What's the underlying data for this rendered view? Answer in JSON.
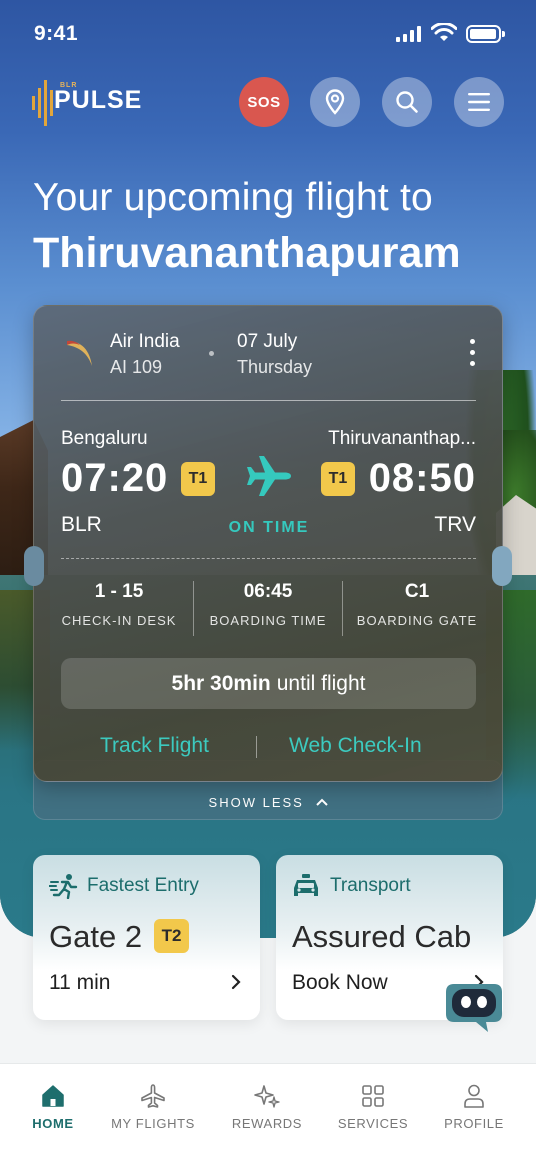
{
  "status_bar": {
    "time": "9:41"
  },
  "header": {
    "logo_text": "PULSE",
    "logo_sub": "BLR",
    "sos_label": "SOS"
  },
  "headline": {
    "line1": "Your upcoming flight to",
    "line2": "Thiruvananthapuram"
  },
  "flight": {
    "airline": "Air India",
    "flight_number": "AI 109",
    "date": "07 July",
    "day": "Thursday",
    "from_city": "Bengaluru",
    "to_city": "Thiruvananthap...",
    "departure_time": "07:20",
    "arrival_time": "08:50",
    "departure_terminal": "T1",
    "arrival_terminal": "T1",
    "from_code": "BLR",
    "to_code": "TRV",
    "status": "ON TIME",
    "status_color": "#35c9be",
    "checkin_desk": "1 - 15",
    "checkin_label": "CHECK-IN DESK",
    "boarding_time": "06:45",
    "boarding_time_label": "BOARDING TIME",
    "boarding_gate": "C1",
    "boarding_gate_label": "BOARDING GATE",
    "countdown_bold": "5hr 30min",
    "countdown_rest": "until flight",
    "track_label": "Track Flight",
    "webcheckin_label": "Web Check-In",
    "show_less_label": "SHOW LESS"
  },
  "quick": {
    "entry_title": "Fastest Entry",
    "entry_gate": "Gate 2",
    "entry_terminal": "T2",
    "entry_time": "11 min",
    "transport_title": "Transport",
    "transport_main": "Assured Cab",
    "transport_action": "Book Now"
  },
  "nav": [
    {
      "label": "HOME",
      "icon": "home-icon",
      "active": true
    },
    {
      "label": "MY FLIGHTS",
      "icon": "plane-icon"
    },
    {
      "label": "REWARDS",
      "icon": "sparkle-icon"
    },
    {
      "label": "SERVICES",
      "icon": "grid-icon"
    },
    {
      "label": "PROFILE",
      "icon": "user-icon"
    }
  ],
  "colors": {
    "accent": "#1e6e6d",
    "teal_text": "#3ccabf",
    "terminal_badge": "#f2c84b",
    "sos": "#d9574f"
  }
}
